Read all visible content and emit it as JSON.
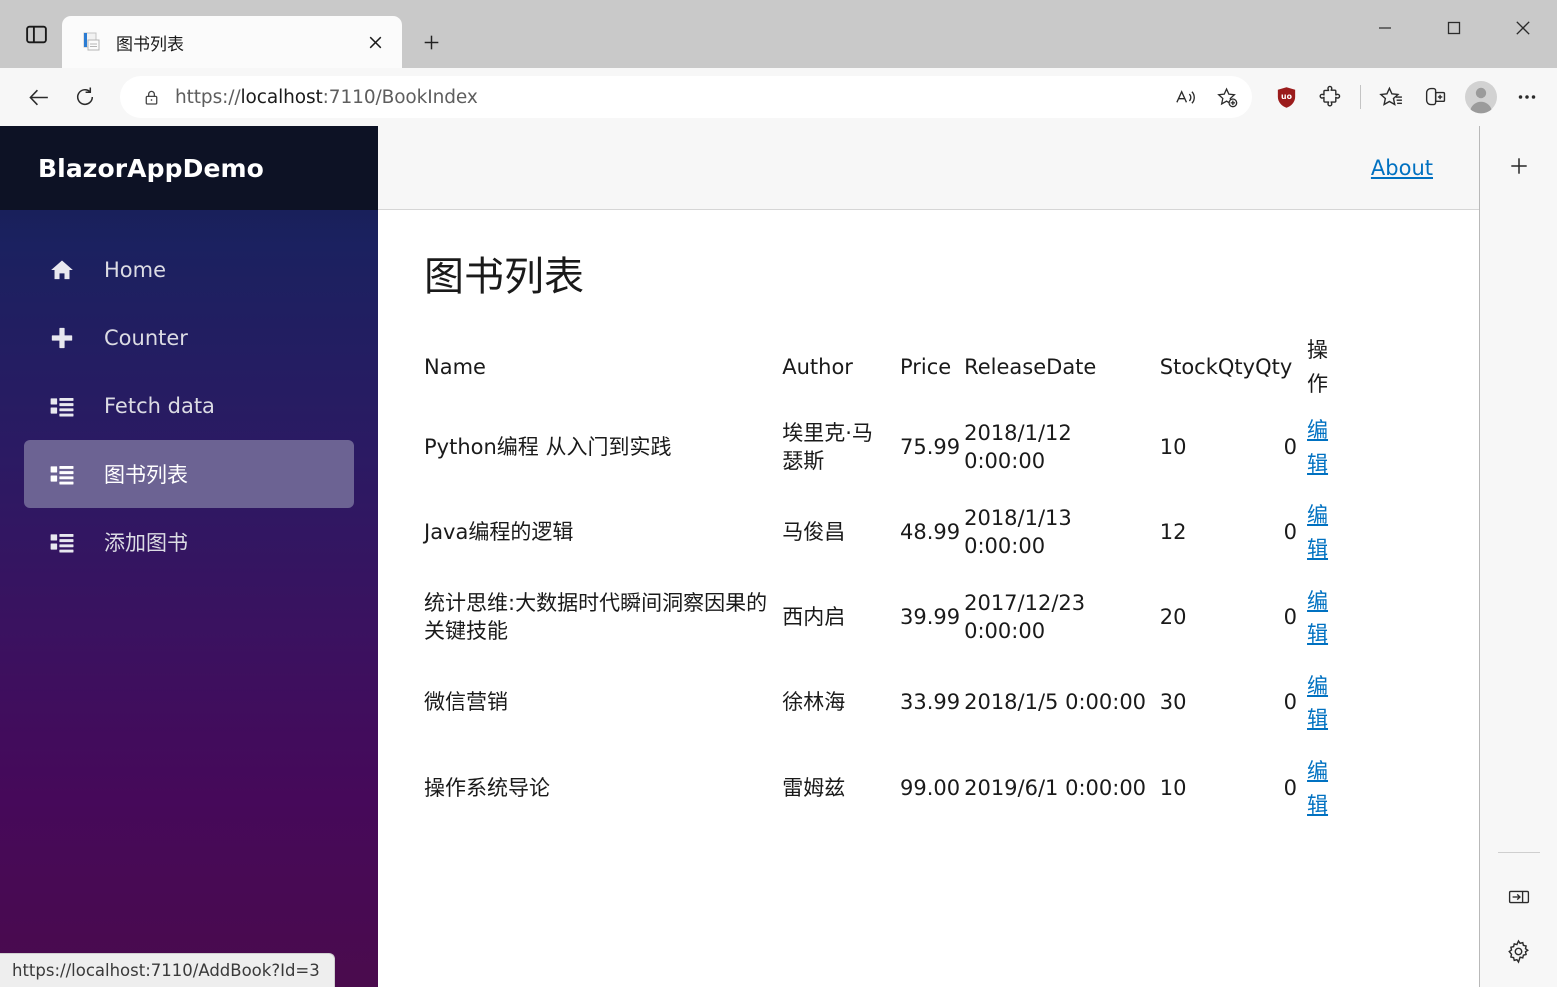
{
  "browser": {
    "tab": {
      "title": "图书列表",
      "favicon_icon": "document-icon",
      "close_icon": "close-icon"
    },
    "toggle_sidebar_icon": "split-pane-icon",
    "new_tab_icon": "plus-icon",
    "window_controls": {
      "minimize_icon": "minimize-icon",
      "maximize_icon": "maximize-icon",
      "close_icon": "close-icon"
    },
    "nav": {
      "back_icon": "arrow-left-icon",
      "refresh_icon": "refresh-icon"
    },
    "omnibox": {
      "lock_icon": "lock-icon",
      "url_prefix": "https://",
      "url_host": "localhost",
      "url_suffix": ":7110/BookIndex",
      "full_url": "https://localhost:7110/BookIndex",
      "read_aloud_icon": "read-aloud-icon",
      "add_favorite_icon": "add-favorite-icon"
    },
    "toolbar": {
      "ublock_icon": "ublock-shield-icon",
      "ublock_color": "#9b1c1c",
      "extensions_icon": "puzzle-piece-icon",
      "favorites_icon": "favorites-star-icon",
      "collections_icon": "collections-icon",
      "profile_icon": "profile-avatar-icon",
      "settings_more_icon": "ellipsis-icon"
    },
    "rail": {
      "add_icon": "plus-icon",
      "expand_panel_icon": "expand-panel-icon",
      "settings_icon": "gear-icon"
    },
    "status_url": "https://localhost:7110/AddBook?Id=3"
  },
  "app": {
    "brand": "BlazorAppDemo",
    "about_label": "About",
    "page_title": "图书列表",
    "sidebar_items": [
      {
        "label": "Home",
        "icon": "home-icon",
        "active": false
      },
      {
        "label": "Counter",
        "icon": "plus-icon",
        "active": false
      },
      {
        "label": "Fetch data",
        "icon": "list-icon",
        "active": false
      },
      {
        "label": "图书列表",
        "icon": "list-icon",
        "active": true
      },
      {
        "label": "添加图书",
        "icon": "list-icon",
        "active": false
      }
    ],
    "table": {
      "headers": {
        "name": "Name",
        "author": "Author",
        "price": "Price",
        "release_date": "ReleaseDate",
        "stock_qty": "StockQty",
        "qty": "Qty",
        "action": "操作"
      },
      "edit_label": "编辑",
      "rows": [
        {
          "name": "Python编程 从入门到实践",
          "author": "埃里克·马瑟斯",
          "price": "75.99",
          "release_date": "2018/1/12 0:00:00",
          "stock_qty": "10",
          "qty": "0",
          "action": "编辑"
        },
        {
          "name": "Java编程的逻辑",
          "author": "马俊昌",
          "price": "48.99",
          "release_date": "2018/1/13 0:00:00",
          "stock_qty": "12",
          "qty": "0",
          "action": "编辑"
        },
        {
          "name": "统计思维:大数据时代瞬间洞察因果的关键技能",
          "author": "西内启",
          "price": "39.99",
          "release_date": "2017/12/23 0:00:00",
          "stock_qty": "20",
          "qty": "0",
          "action": "编辑"
        },
        {
          "name": "微信营销",
          "author": "徐林海",
          "price": "33.99",
          "release_date": "2018/1/5 0:00:00",
          "stock_qty": "30",
          "qty": "0",
          "action": "编辑"
        },
        {
          "name": "操作系统导论",
          "author": "雷姆兹",
          "price": "99.00",
          "release_date": "2019/6/1 0:00:00",
          "stock_qty": "10",
          "qty": "0",
          "action": "编辑"
        }
      ]
    }
  },
  "colors": {
    "link": "#0071c1",
    "sidebar_active": "#6c6393",
    "brand_bar": "#0d1225"
  }
}
